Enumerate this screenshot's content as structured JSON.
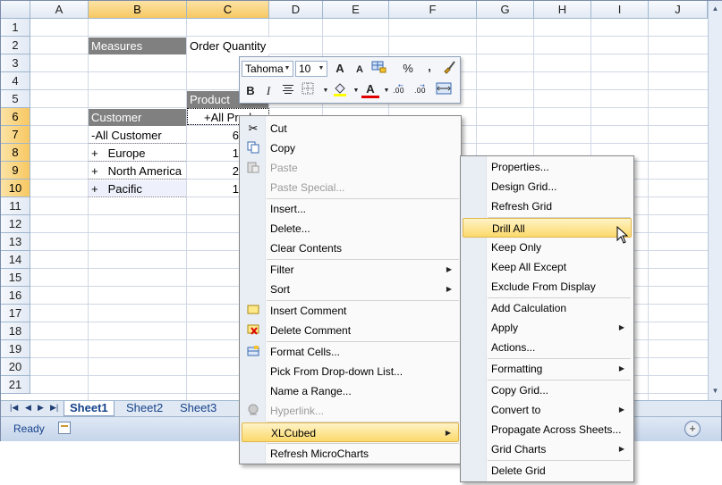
{
  "columns": [
    "A",
    "B",
    "C",
    "D",
    "E",
    "F",
    "G",
    "H",
    "I",
    "J"
  ],
  "selected_columns": [
    "B",
    "C"
  ],
  "rows": [
    "1",
    "2",
    "3",
    "4",
    "5",
    "6",
    "7",
    "8",
    "9",
    "10",
    "11",
    "12",
    "13",
    "14",
    "15",
    "16",
    "17",
    "18",
    "19",
    "20",
    "21"
  ],
  "selected_rows": [
    "6",
    "7",
    "8",
    "9",
    "10"
  ],
  "cells": {
    "b2": "Measures",
    "c2": "Order Quantity",
    "c5": "Product",
    "b6": "Customer",
    "c6": "+All Produ",
    "b7": "-All Customer",
    "c7": "6",
    "b8_sign": "+",
    "b8": "Europe",
    "c8": "1",
    "b9_sign": "+",
    "b9": "North America",
    "c9": "2",
    "b10_sign": "+",
    "b10": "Pacific",
    "c10": "1"
  },
  "mini_toolbar": {
    "font": "Tahoma",
    "size": "10",
    "buttons": [
      "grow-font-icon",
      "shrink-font-icon",
      "format-painter-table-icon",
      "percent-icon",
      "comma-icon",
      "paintbrush-icon",
      "bold-icon",
      "italic-icon",
      "center-align-icon",
      "borders-icon",
      "fill-color-icon",
      "font-color-icon",
      "increase-decimal-icon",
      "decrease-decimal-icon",
      "merge-center-icon"
    ],
    "labels": {
      "grow": "A",
      "shrink": "A",
      "percent": "%",
      "comma": ",",
      "bold": "B",
      "italic": "I",
      "fontcolor": "A"
    }
  },
  "context_menu": {
    "items": [
      {
        "label": "Cut",
        "enabled": true,
        "icon": "scissors-icon"
      },
      {
        "label": "Copy",
        "enabled": true,
        "icon": "copy-icon"
      },
      {
        "label": "Paste",
        "enabled": false,
        "icon": "paste-icon"
      },
      {
        "label": "Paste Special...",
        "enabled": false
      },
      {
        "label": "Insert...",
        "enabled": true
      },
      {
        "label": "Delete...",
        "enabled": true
      },
      {
        "label": "Clear Contents",
        "enabled": true
      },
      {
        "label": "Filter",
        "enabled": true,
        "submenu": true
      },
      {
        "label": "Sort",
        "enabled": true,
        "submenu": true
      },
      {
        "label": "Insert Comment",
        "enabled": true,
        "icon": "comment-icon"
      },
      {
        "label": "Delete Comment",
        "enabled": true,
        "icon": "delete-comment-icon"
      },
      {
        "label": "Format Cells...",
        "enabled": true,
        "icon": "format-cells-icon"
      },
      {
        "label": "Pick From Drop-down List...",
        "enabled": true
      },
      {
        "label": "Name a Range...",
        "enabled": true
      },
      {
        "label": "Hyperlink...",
        "enabled": false,
        "icon": "hyperlink-icon"
      },
      {
        "label": "XLCubed",
        "enabled": true,
        "submenu": true,
        "highlighted": true
      },
      {
        "label": "Refresh MicroCharts",
        "enabled": true
      }
    ]
  },
  "submenu": {
    "items": [
      {
        "label": "Properties..."
      },
      {
        "label": "Design Grid..."
      },
      {
        "label": "Refresh Grid"
      },
      {
        "label": "Drill All",
        "highlighted": true
      },
      {
        "label": "Keep Only"
      },
      {
        "label": "Keep All Except"
      },
      {
        "label": "Exclude From Display"
      },
      {
        "label": "Add Calculation"
      },
      {
        "label": "Apply",
        "submenu": true
      },
      {
        "label": "Actions..."
      },
      {
        "label": "Formatting",
        "submenu": true
      },
      {
        "label": "Copy Grid..."
      },
      {
        "label": "Convert to",
        "submenu": true
      },
      {
        "label": "Propagate Across Sheets..."
      },
      {
        "label": "Grid Charts",
        "submenu": true
      },
      {
        "label": "Delete Grid"
      }
    ]
  },
  "sheet_tabs": [
    "Sheet1",
    "Sheet2",
    "Sheet3"
  ],
  "active_tab": "Sheet1",
  "status": "Ready",
  "zoom_button": "+",
  "colors": {
    "header_selected": "#f7c862",
    "highlight": "#fbd96b",
    "dark_cell": "#808080",
    "tab_text": "#15428b"
  }
}
